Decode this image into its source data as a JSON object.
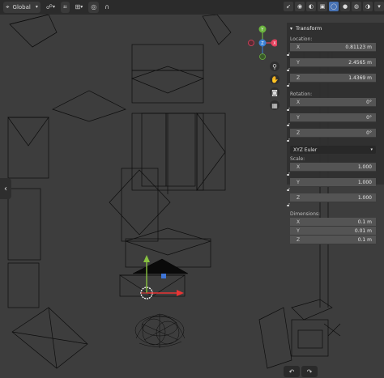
{
  "header": {
    "orientation_label": "Global",
    "orientation_icon": "transform-orientation-icon",
    "pivot_icon": "pivot-icon",
    "snap_icon": "snap-icon",
    "proportional_icon": "proportional-edit-icon",
    "right_icons": [
      "cursor-icon",
      "visibility-icon",
      "overlay-icon",
      "xray-icon",
      "shading-wireframe-icon",
      "shading-solid-icon",
      "shading-material-icon",
      "shading-rendered-icon",
      "overlay-popover-icon"
    ]
  },
  "panel": {
    "title": "Transform",
    "location_label": "Location:",
    "location": [
      {
        "axis": "X",
        "value": "0.81123 m"
      },
      {
        "axis": "Y",
        "value": "2.4565 m"
      },
      {
        "axis": "Z",
        "value": "1.4369 m"
      }
    ],
    "rotation_label": "Rotation:",
    "rotation": [
      {
        "axis": "X",
        "value": "0°"
      },
      {
        "axis": "Y",
        "value": "0°"
      },
      {
        "axis": "Z",
        "value": "0°"
      }
    ],
    "rotation_mode": "XYZ Euler",
    "scale_label": "Scale:",
    "scale": [
      {
        "axis": "X",
        "value": "1.000"
      },
      {
        "axis": "Y",
        "value": "1.000"
      },
      {
        "axis": "Z",
        "value": "1.000"
      }
    ],
    "dimensions_label": "Dimensions:",
    "dimensions": [
      {
        "axis": "X",
        "value": "0.1 m"
      },
      {
        "axis": "Y",
        "value": "0.01 m"
      },
      {
        "axis": "Z",
        "value": "0.1 m"
      }
    ]
  },
  "gizmo": {
    "x": "X",
    "y": "Y",
    "z": "Z"
  },
  "colors": {
    "x_axis": "#e4415e",
    "y_axis": "#6ab33e",
    "z_axis": "#3b82d6",
    "accent": "#4772b3",
    "move_x": "#e83535",
    "move_y": "#88c240",
    "move_z": "#3f75d6"
  }
}
